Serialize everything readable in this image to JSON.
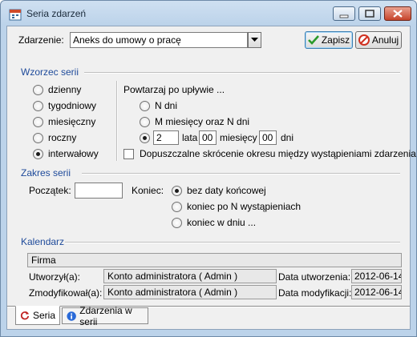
{
  "window": {
    "title": "Seria zdarzeń",
    "icon": "calendar-app-icon"
  },
  "header": {
    "event_label": "Zdarzenie:",
    "event_value": "Aneks do umowy o pracę",
    "save_label": "Zapisz",
    "cancel_label": "Anuluj"
  },
  "pattern": {
    "section_title": "Wzorzec serii",
    "types": [
      {
        "label": "dzienny",
        "selected": false
      },
      {
        "label": "tygodniowy",
        "selected": false
      },
      {
        "label": "miesięczny",
        "selected": false
      },
      {
        "label": "roczny",
        "selected": false
      },
      {
        "label": "interwałowy",
        "selected": true
      }
    ],
    "repeat_title": "Powtarzaj po upływie ...",
    "options": {
      "n_days": "N dni",
      "m_months_n_days": "M miesięcy oraz N dni",
      "years_value": "2",
      "years_label": "lata",
      "months_value": "00",
      "months_label": "miesięcy",
      "days_value": "00",
      "days_label": "dni"
    },
    "allow_shortening_label": "Dopuszczalne skrócenie okresu między wystąpieniami zdarzenia",
    "allow_shortening_checked": false
  },
  "range": {
    "section_title": "Zakres serii",
    "start_label": "Początek:",
    "start_value": "",
    "end_label": "Koniec:",
    "end_options": [
      {
        "label": "bez daty końcowej",
        "selected": true
      },
      {
        "label": "koniec po N wystąpieniach",
        "selected": false
      },
      {
        "label": "koniec w dniu ...",
        "selected": false
      }
    ]
  },
  "calendar": {
    "section_title": "Kalendarz",
    "calendar_value": "Firma",
    "created_by_label": "Utworzył(a):",
    "created_by_value": "Konto administratora ( Admin )",
    "created_date_label": "Data utworzenia:",
    "created_date_value": "2012-06-14",
    "modified_by_label": "Zmodyfikował(a):",
    "modified_by_value": "Konto administratora ( Admin )",
    "modified_date_label": "Data modyfikacji:",
    "modified_date_value": "2012-06-14"
  },
  "tabs": [
    {
      "label": "Seria",
      "icon": "refresh-icon",
      "active": true
    },
    {
      "label": "Zdarzenia w serii",
      "icon": "info-icon",
      "active": false
    }
  ],
  "colors": {
    "section_title": "#1e4a9a",
    "save_check": "#2a9a2a",
    "cancel_icon": "#d03020"
  }
}
